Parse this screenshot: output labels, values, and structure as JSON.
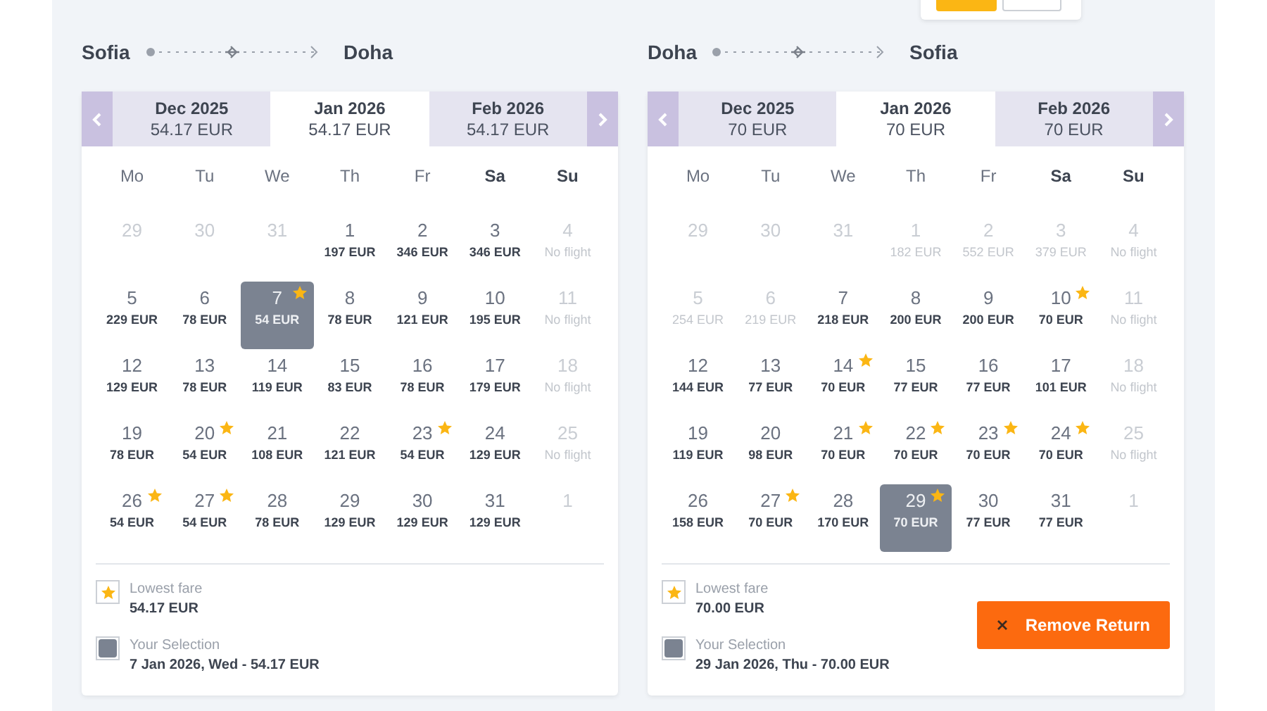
{
  "view_toggle": [
    {
      "selected": true
    },
    {
      "selected": false
    }
  ],
  "calendars": [
    {
      "from": "Sofia",
      "to": "Doha",
      "months": [
        {
          "label": "Dec 2025",
          "price": "54.17 EUR",
          "selected": false
        },
        {
          "label": "Jan 2026",
          "price": "54.17 EUR",
          "selected": true
        },
        {
          "label": "Feb 2026",
          "price": "54.17 EUR",
          "selected": false
        }
      ],
      "weekdays": [
        {
          "label": "Mo",
          "weekend": false
        },
        {
          "label": "Tu",
          "weekend": false
        },
        {
          "label": "We",
          "weekend": false
        },
        {
          "label": "Th",
          "weekend": false
        },
        {
          "label": "Fr",
          "weekend": false
        },
        {
          "label": "Sa",
          "weekend": true
        },
        {
          "label": "Su",
          "weekend": true
        }
      ],
      "weeks": [
        [
          {
            "day": "29",
            "muted": true,
            "star": false,
            "selected": false
          },
          {
            "day": "30",
            "muted": true,
            "star": false,
            "selected": false
          },
          {
            "day": "31",
            "muted": true,
            "star": false,
            "selected": false
          },
          {
            "day": "1",
            "price": "197 EUR",
            "muted": false,
            "star": false,
            "selected": false
          },
          {
            "day": "2",
            "price": "346 EUR",
            "muted": false,
            "star": false,
            "selected": false
          },
          {
            "day": "3",
            "price": "346 EUR",
            "muted": false,
            "star": false,
            "selected": false
          },
          {
            "day": "4",
            "price": "No flight",
            "muted": true,
            "star": false,
            "selected": false
          }
        ],
        [
          {
            "day": "5",
            "price": "229 EUR",
            "muted": false,
            "star": false,
            "selected": false
          },
          {
            "day": "6",
            "price": "78 EUR",
            "muted": false,
            "star": false,
            "selected": false
          },
          {
            "day": "7",
            "price": "54 EUR",
            "muted": false,
            "star": true,
            "selected": true
          },
          {
            "day": "8",
            "price": "78 EUR",
            "muted": false,
            "star": false,
            "selected": false
          },
          {
            "day": "9",
            "price": "121 EUR",
            "muted": false,
            "star": false,
            "selected": false
          },
          {
            "day": "10",
            "price": "195 EUR",
            "muted": false,
            "star": false,
            "selected": false
          },
          {
            "day": "11",
            "price": "No flight",
            "muted": true,
            "star": false,
            "selected": false
          }
        ],
        [
          {
            "day": "12",
            "price": "129 EUR",
            "muted": false,
            "star": false,
            "selected": false
          },
          {
            "day": "13",
            "price": "78 EUR",
            "muted": false,
            "star": false,
            "selected": false
          },
          {
            "day": "14",
            "price": "119 EUR",
            "muted": false,
            "star": false,
            "selected": false
          },
          {
            "day": "15",
            "price": "83 EUR",
            "muted": false,
            "star": false,
            "selected": false
          },
          {
            "day": "16",
            "price": "78 EUR",
            "muted": false,
            "star": false,
            "selected": false
          },
          {
            "day": "17",
            "price": "179 EUR",
            "muted": false,
            "star": false,
            "selected": false
          },
          {
            "day": "18",
            "price": "No flight",
            "muted": true,
            "star": false,
            "selected": false
          }
        ],
        [
          {
            "day": "19",
            "price": "78 EUR",
            "muted": false,
            "star": false,
            "selected": false
          },
          {
            "day": "20",
            "price": "54 EUR",
            "muted": false,
            "star": true,
            "selected": false
          },
          {
            "day": "21",
            "price": "108 EUR",
            "muted": false,
            "star": false,
            "selected": false
          },
          {
            "day": "22",
            "price": "121 EUR",
            "muted": false,
            "star": false,
            "selected": false
          },
          {
            "day": "23",
            "price": "54 EUR",
            "muted": false,
            "star": true,
            "selected": false
          },
          {
            "day": "24",
            "price": "129 EUR",
            "muted": false,
            "star": false,
            "selected": false
          },
          {
            "day": "25",
            "price": "No flight",
            "muted": true,
            "star": false,
            "selected": false
          }
        ],
        [
          {
            "day": "26",
            "price": "54 EUR",
            "muted": false,
            "star": true,
            "selected": false
          },
          {
            "day": "27",
            "price": "54 EUR",
            "muted": false,
            "star": true,
            "selected": false
          },
          {
            "day": "28",
            "price": "78 EUR",
            "muted": false,
            "star": false,
            "selected": false
          },
          {
            "day": "29",
            "price": "129 EUR",
            "muted": false,
            "star": false,
            "selected": false
          },
          {
            "day": "30",
            "price": "129 EUR",
            "muted": false,
            "star": false,
            "selected": false
          },
          {
            "day": "31",
            "price": "129 EUR",
            "muted": false,
            "star": false,
            "selected": false
          },
          {
            "day": "1",
            "muted": true,
            "star": false,
            "selected": false
          }
        ]
      ],
      "legend": {
        "lowest_label": "Lowest fare",
        "lowest_value": "54.17 EUR",
        "selection_label": "Your Selection",
        "selection_value": "7 Jan 2026, Wed - 54.17 EUR"
      }
    },
    {
      "from": "Doha",
      "to": "Sofia",
      "months": [
        {
          "label": "Dec 2025",
          "price": "70 EUR",
          "selected": false
        },
        {
          "label": "Jan 2026",
          "price": "70 EUR",
          "selected": true
        },
        {
          "label": "Feb 2026",
          "price": "70 EUR",
          "selected": false
        }
      ],
      "weekdays": [
        {
          "label": "Mo",
          "weekend": false
        },
        {
          "label": "Tu",
          "weekend": false
        },
        {
          "label": "We",
          "weekend": false
        },
        {
          "label": "Th",
          "weekend": false
        },
        {
          "label": "Fr",
          "weekend": false
        },
        {
          "label": "Sa",
          "weekend": true
        },
        {
          "label": "Su",
          "weekend": true
        }
      ],
      "weeks": [
        [
          {
            "day": "29",
            "muted": true,
            "star": false,
            "selected": false
          },
          {
            "day": "30",
            "muted": true,
            "star": false,
            "selected": false
          },
          {
            "day": "31",
            "muted": true,
            "star": false,
            "selected": false
          },
          {
            "day": "1",
            "price": "182 EUR",
            "muted": true,
            "star": false,
            "selected": false
          },
          {
            "day": "2",
            "price": "552 EUR",
            "muted": true,
            "star": false,
            "selected": false
          },
          {
            "day": "3",
            "price": "379 EUR",
            "muted": true,
            "star": false,
            "selected": false
          },
          {
            "day": "4",
            "price": "No flight",
            "muted": true,
            "star": false,
            "selected": false
          }
        ],
        [
          {
            "day": "5",
            "price": "254 EUR",
            "muted": true,
            "star": false,
            "selected": false
          },
          {
            "day": "6",
            "price": "219 EUR",
            "muted": true,
            "star": false,
            "selected": false
          },
          {
            "day": "7",
            "price": "218 EUR",
            "muted": false,
            "star": false,
            "selected": false
          },
          {
            "day": "8",
            "price": "200 EUR",
            "muted": false,
            "star": false,
            "selected": false
          },
          {
            "day": "9",
            "price": "200 EUR",
            "muted": false,
            "star": false,
            "selected": false
          },
          {
            "day": "10",
            "price": "70 EUR",
            "muted": false,
            "star": true,
            "selected": false
          },
          {
            "day": "11",
            "price": "No flight",
            "muted": true,
            "star": false,
            "selected": false
          }
        ],
        [
          {
            "day": "12",
            "price": "144 EUR",
            "muted": false,
            "star": false,
            "selected": false
          },
          {
            "day": "13",
            "price": "77 EUR",
            "muted": false,
            "star": false,
            "selected": false
          },
          {
            "day": "14",
            "price": "70 EUR",
            "muted": false,
            "star": true,
            "selected": false
          },
          {
            "day": "15",
            "price": "77 EUR",
            "muted": false,
            "star": false,
            "selected": false
          },
          {
            "day": "16",
            "price": "77 EUR",
            "muted": false,
            "star": false,
            "selected": false
          },
          {
            "day": "17",
            "price": "101 EUR",
            "muted": false,
            "star": false,
            "selected": false
          },
          {
            "day": "18",
            "price": "No flight",
            "muted": true,
            "star": false,
            "selected": false
          }
        ],
        [
          {
            "day": "19",
            "price": "119 EUR",
            "muted": false,
            "star": false,
            "selected": false
          },
          {
            "day": "20",
            "price": "98 EUR",
            "muted": false,
            "star": false,
            "selected": false
          },
          {
            "day": "21",
            "price": "70 EUR",
            "muted": false,
            "star": true,
            "selected": false
          },
          {
            "day": "22",
            "price": "70 EUR",
            "muted": false,
            "star": true,
            "selected": false
          },
          {
            "day": "23",
            "price": "70 EUR",
            "muted": false,
            "star": true,
            "selected": false
          },
          {
            "day": "24",
            "price": "70 EUR",
            "muted": false,
            "star": true,
            "selected": false
          },
          {
            "day": "25",
            "price": "No flight",
            "muted": true,
            "star": false,
            "selected": false
          }
        ],
        [
          {
            "day": "26",
            "price": "158 EUR",
            "muted": false,
            "star": false,
            "selected": false
          },
          {
            "day": "27",
            "price": "70 EUR",
            "muted": false,
            "star": true,
            "selected": false
          },
          {
            "day": "28",
            "price": "170 EUR",
            "muted": false,
            "star": false,
            "selected": false
          },
          {
            "day": "29",
            "price": "70 EUR",
            "muted": false,
            "star": true,
            "selected": true
          },
          {
            "day": "30",
            "price": "77 EUR",
            "muted": false,
            "star": false,
            "selected": false
          },
          {
            "day": "31",
            "price": "77 EUR",
            "muted": false,
            "star": false,
            "selected": false
          },
          {
            "day": "1",
            "muted": true,
            "star": false,
            "selected": false
          }
        ]
      ],
      "legend": {
        "lowest_label": "Lowest fare",
        "lowest_value": "70.00 EUR",
        "selection_label": "Your Selection",
        "selection_value": "29 Jan 2026, Thu - 70.00 EUR"
      },
      "remove_button": "Remove Return"
    }
  ]
}
